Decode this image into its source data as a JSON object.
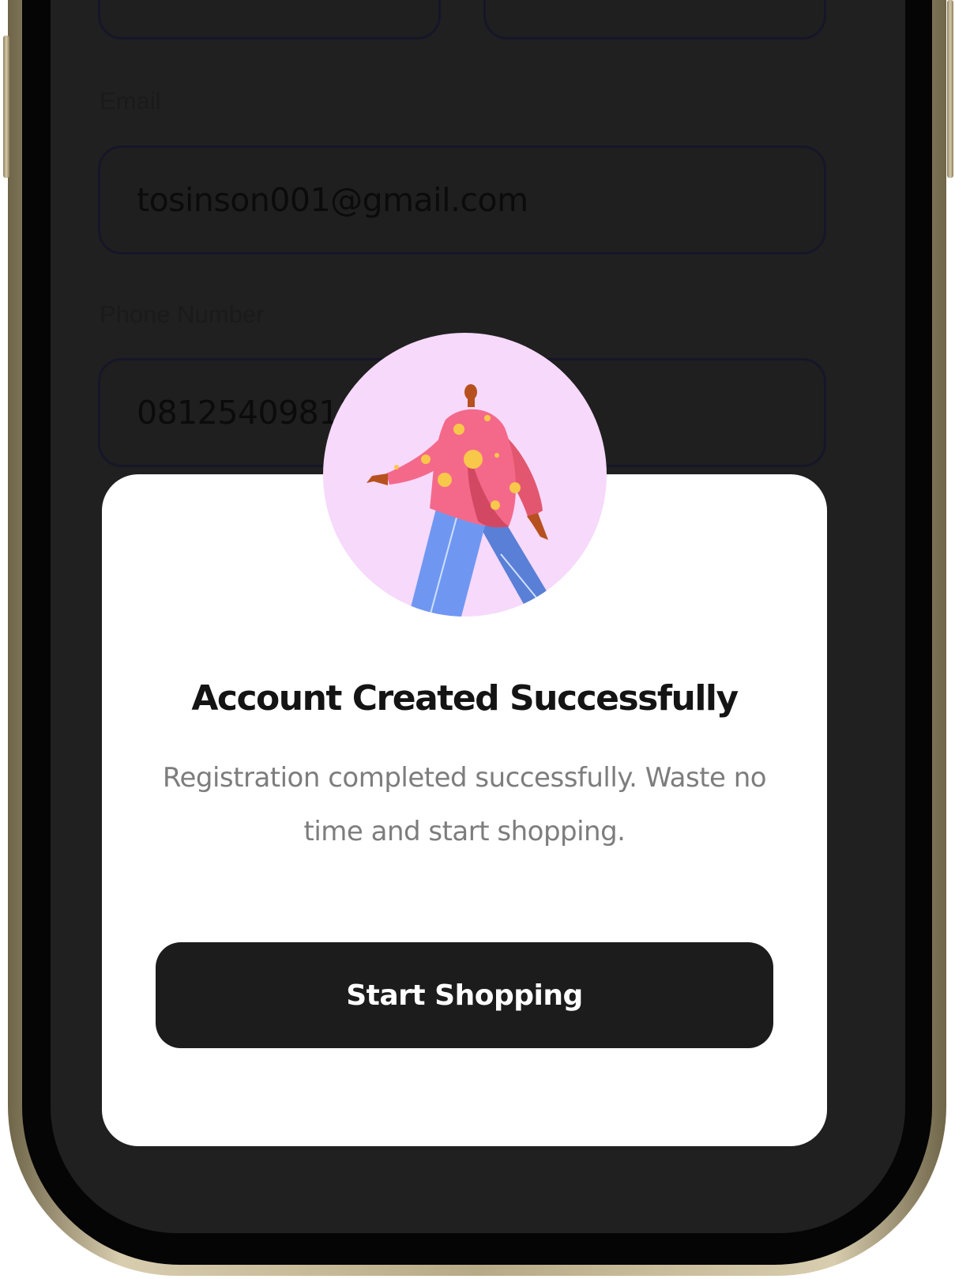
{
  "form": {
    "email_label": "Email",
    "email_value": "tosinson001@gmail.com",
    "phone_label": "Phone Number",
    "phone_value": "08125409813"
  },
  "modal": {
    "title": "Account Created Successfully",
    "message": "Registration completed successfully. Waste no time and start shopping.",
    "button_label": "Start Shopping",
    "illustration": "walking-person-illustration"
  },
  "colors": {
    "screen_background": "#202020",
    "modal_background": "#ffffff",
    "button_background": "#1c1c1c",
    "avatar_background": "#f6d9fb"
  }
}
